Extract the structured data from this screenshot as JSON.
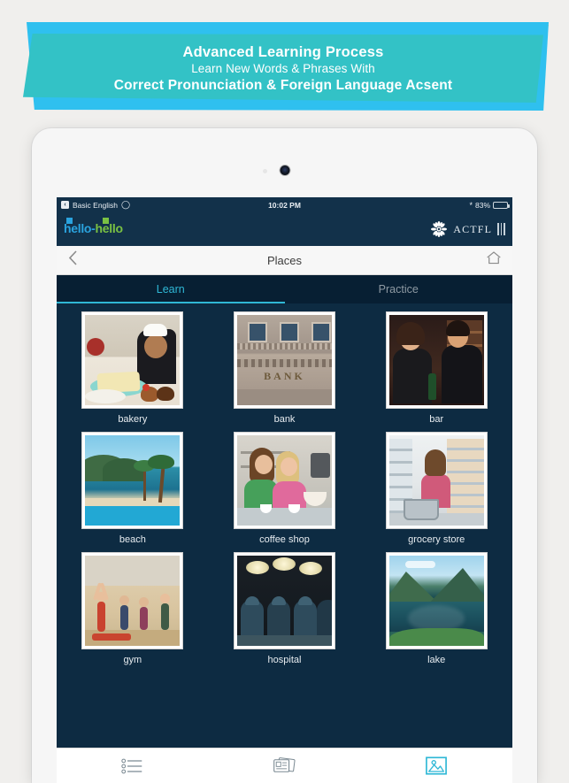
{
  "banner": {
    "line1": "Advanced Learning Process",
    "line2": "Learn New Words & Phrases With",
    "line3": "Correct Pronunciation  &  Foreign Language Acsent",
    "colors": {
      "teal": "#33c2c6",
      "yellow": "#fdc82a",
      "light_blue": "#2fc0ef",
      "text": "#ffffff"
    }
  },
  "status_bar": {
    "back_glyph": "‹",
    "back_label": "Basic English",
    "wifi_icon": "wifi-icon",
    "time": "10:02 PM",
    "bluetooth_icon": "bluetooth-icon",
    "battery_percent": "83%",
    "battery_level": 83,
    "battery_color": "#4cd562"
  },
  "brand_bar": {
    "logo_part1": "hello",
    "logo_sep": "-",
    "logo_part2": "hello",
    "logo_blue": "#2aa3de",
    "logo_green": "#7ac143",
    "partner_label": "ACTFL",
    "menu_icon": "menu-bars-icon"
  },
  "nav_bar": {
    "back_icon": "chevron-left-icon",
    "title": "Places",
    "home_icon": "home-icon"
  },
  "tabs": {
    "items": [
      {
        "label": "Learn",
        "active": true
      },
      {
        "label": "Practice",
        "active": false
      }
    ],
    "active_color": "#2fb8d6",
    "inactive_color": "#8e9aa3"
  },
  "grid": {
    "rows": [
      [
        {
          "label": "bakery",
          "art": "a-bakery"
        },
        {
          "label": "bank",
          "art": "a-bank"
        },
        {
          "label": "bar",
          "art": "a-bar"
        }
      ],
      [
        {
          "label": "beach",
          "art": "a-beach"
        },
        {
          "label": "coffee shop",
          "art": "a-coffee"
        },
        {
          "label": "grocery store",
          "art": "a-groc"
        }
      ],
      [
        {
          "label": "gym",
          "art": "a-gym"
        },
        {
          "label": "hospital",
          "art": "a-hosp"
        },
        {
          "label": "lake",
          "art": "a-lake"
        }
      ]
    ],
    "background": "#0d2b42"
  },
  "toolbar": {
    "items": [
      {
        "name": "list-view-icon",
        "active": false
      },
      {
        "name": "flashcards-icon",
        "active": false
      },
      {
        "name": "image-view-icon",
        "active": true
      }
    ],
    "active_color": "#2fb8d6",
    "inactive_color": "#7b8a93"
  }
}
